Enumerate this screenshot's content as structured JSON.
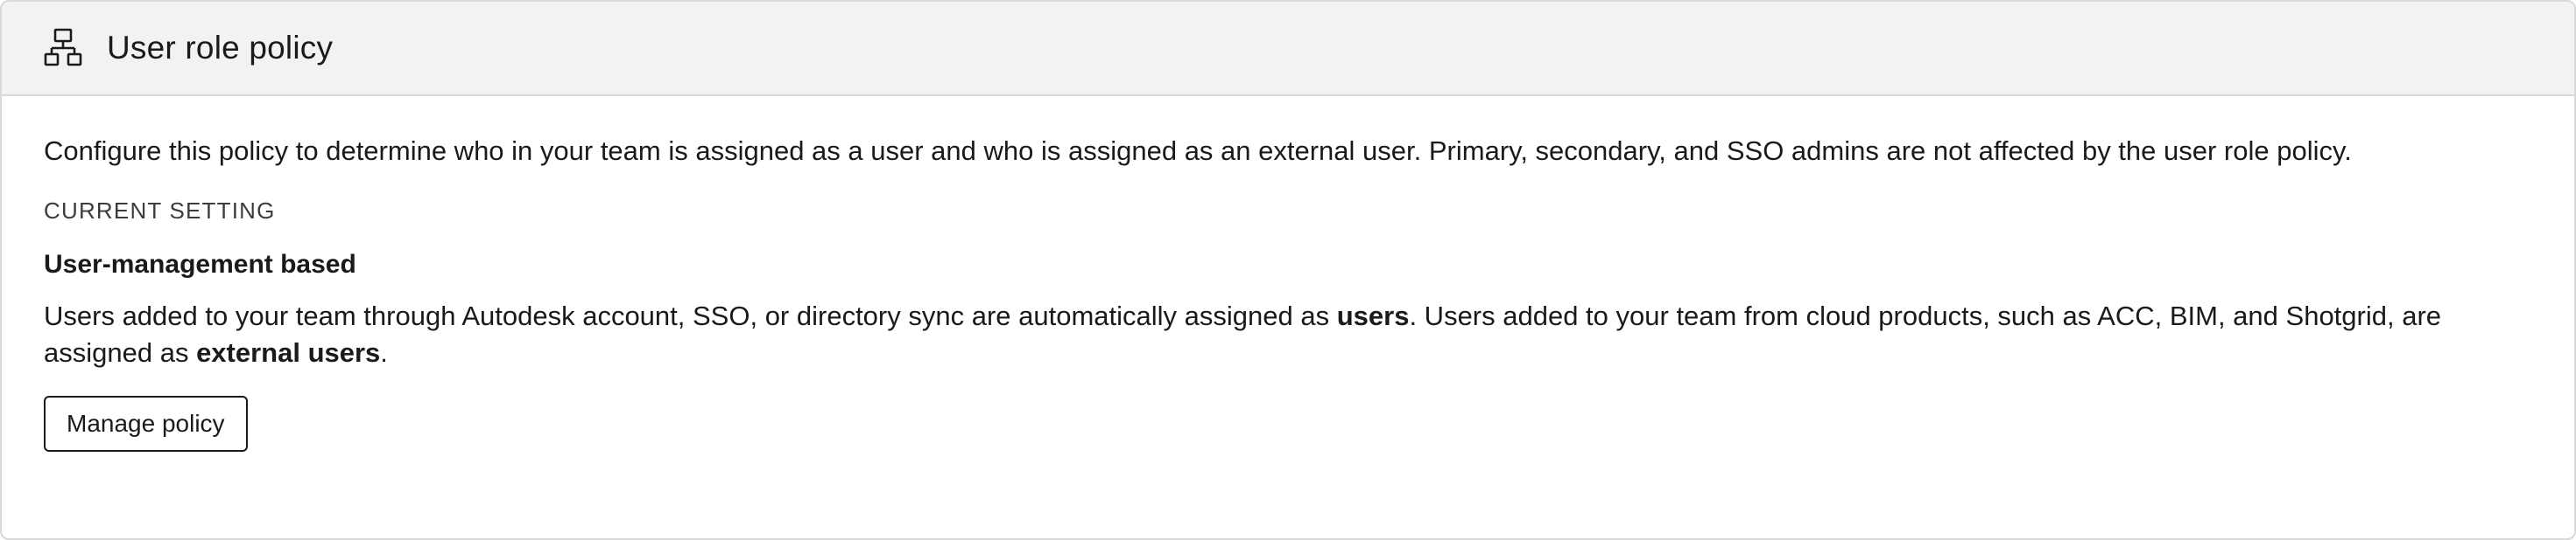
{
  "card": {
    "title": "User role policy",
    "icon": "hierarchy-icon",
    "description": "Configure this policy to determine who in your team is assigned as a user and who is assigned as an external user. Primary, secondary, and SSO admins are not affected by the user role policy.",
    "current_setting_label": "CURRENT SETTING",
    "setting_name": "User-management based",
    "setting_desc": {
      "part1": "Users added to your team through Autodesk account, SSO, or directory sync are automatically assigned as ",
      "bold1": "users",
      "part2": ". Users added to your team from cloud products, such as ACC, BIM, and Shotgrid, are assigned as ",
      "bold2": "external users",
      "part3": "."
    },
    "manage_button_label": "Manage policy"
  },
  "colors": {
    "header_bg": "#f2f2f2",
    "border": "#d9d9d9",
    "text": "#1a1a1a"
  }
}
